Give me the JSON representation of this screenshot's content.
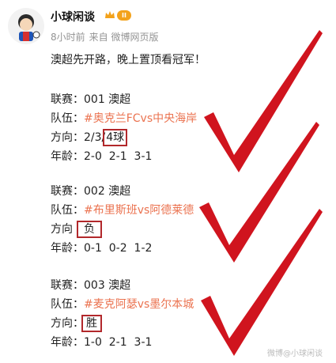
{
  "post": {
    "username": "小球闲谈",
    "level": "II",
    "time": "8小时前",
    "source": "来自 微博网页版",
    "intro": "澳超先开路，晚上置顶看冠军！"
  },
  "matches": [
    {
      "league_label": "联赛：",
      "league_value": "001 澳超",
      "team_label": "队伍：",
      "team_value": "#奥克兰FCvs中央海岸",
      "direction_label": "方向：",
      "direction_prefix": "2/3/",
      "direction_box": "4球",
      "age_label": "年龄：",
      "age_value": "2-0  2-1  3-1"
    },
    {
      "league_label": "联赛：",
      "league_value": "002 澳超",
      "team_label": "队伍：",
      "team_value": "#布里斯班vs阿德莱德",
      "direction_label": "方向",
      "direction_prefix": "",
      "direction_box": "负",
      "age_label": "年龄：",
      "age_value": "0-1  0-2  1-2"
    },
    {
      "league_label": "联赛：",
      "league_value": "003 澳超",
      "team_label": "队伍：",
      "team_value": "#麦克阿瑟vs墨尔本城",
      "direction_label": "方向：",
      "direction_prefix": "",
      "direction_box": "胜",
      "age_label": "年龄：",
      "age_value": "1-0  2-1  3-1"
    }
  ],
  "watermark": "微博@小球闲谈",
  "colors": {
    "topic": "#eb7350",
    "check": "#d0141e",
    "box": "#b2282b"
  },
  "icons": [
    "avatar",
    "crown-badge-icon",
    "check-mark-icon"
  ]
}
